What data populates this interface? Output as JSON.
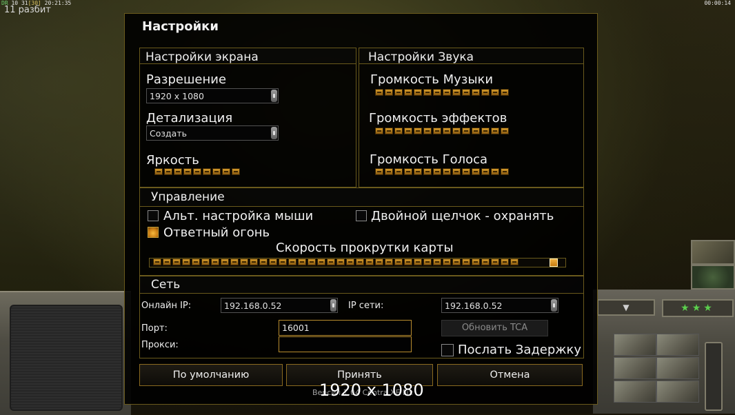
{
  "hud": {
    "top_left_prefix": "DR",
    "top_left_a": "10",
    "top_left_b": "31",
    "top_left_c": "[30]",
    "top_left_time": "20:21:35",
    "count_label": "11 разбит",
    "timer": "00:00:14"
  },
  "dialog": {
    "title": "Настройки"
  },
  "screen_settings": {
    "title": "Настройки экрана",
    "resolution_label": "Разрешение",
    "resolution_value": "1920 x 1080",
    "detail_label": "Детализация",
    "detail_value": "Создать",
    "brightness_label": "Яркость",
    "brightness_level_segments": 9
  },
  "sound_settings": {
    "title": "Настройки Звука",
    "music_label": "Громкость Музыки",
    "music_segments": 14,
    "effects_label": "Громкость эффектов",
    "effects_segments": 14,
    "voice_label": "Громкость Голоса",
    "voice_segments": 14
  },
  "controls": {
    "title": "Управление",
    "alt_mouse_label": "Альт. настройка мыши",
    "alt_mouse_checked": false,
    "double_click_label": "Двойной щелчок - охранять",
    "double_click_checked": false,
    "return_fire_label": "Ответный огонь",
    "return_fire_checked": true,
    "scroll_speed_label": "Скорость прокрутки карты",
    "scroll_speed_segments": 38
  },
  "network": {
    "title": "Сеть",
    "online_ip_label": "Онлайн IP:",
    "online_ip_value": "192.168.0.52",
    "network_ip_label": "IP сети:",
    "network_ip_value": "192.168.0.52",
    "port_label": "Порт:",
    "port_value": "16001",
    "proxy_label": "Прокси:",
    "proxy_value": "",
    "update_tca_label": "Обновить TCA",
    "send_delay_label": "Послать Задержку",
    "send_delay_checked": false
  },
  "buttons": {
    "defaults": "По умолчанию",
    "accept": "Принять",
    "cancel": "Отмена"
  },
  "tooltip": "1920 x 1080",
  "ghost_text": "Версия 1.04 Contra XE Fix",
  "colors": {
    "accent_gold": "#b98d2e",
    "frame": "#6a5a1c",
    "segment": "#d49a2a",
    "star_green": "#5bcf4d"
  }
}
